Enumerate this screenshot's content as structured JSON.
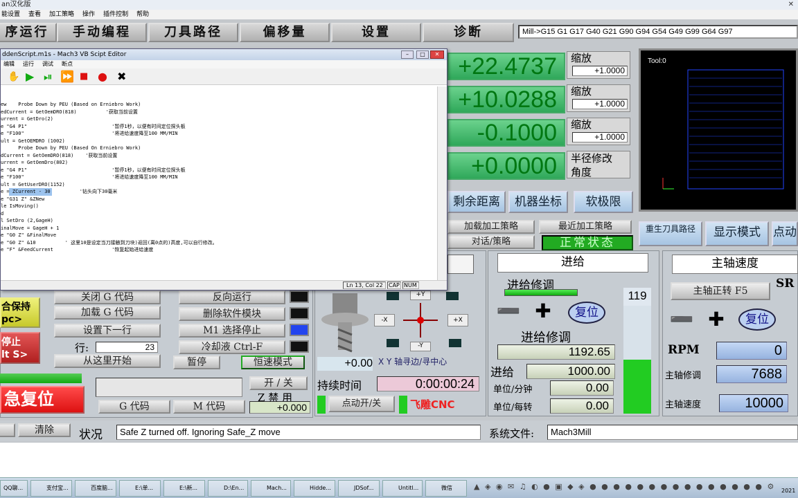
{
  "window": {
    "title": "an汉化版"
  },
  "menubar": [
    "能设置",
    "查看",
    "加工策略",
    "操作",
    "插件控制",
    "帮助"
  ],
  "tabs": [
    "序运行",
    "手动编程",
    "刀具路径",
    "偏移量",
    "设置",
    "诊断"
  ],
  "mdi": "Mill->G15  G1 G17 G40 G21 G90 G94 G54 G49 G99 G64 G97",
  "dros": [
    {
      "value": "+22.4737",
      "scale_label": "缩放",
      "scale": "+1.0000"
    },
    {
      "value": "+10.0288",
      "scale_label": "缩放",
      "scale": "+1.0000"
    },
    {
      "value": "-0.1000",
      "scale_label": "缩放",
      "scale": "+1.0000"
    },
    {
      "value": "+0.0000",
      "scale_label": "半径修改\n角度"
    }
  ],
  "tool_label": "Tool:0",
  "coord_buttons": [
    "剩余距离",
    "机器坐标",
    "软极限"
  ],
  "strategy": {
    "load": "加载加工策略",
    "recent": "最近加工策略",
    "dialog": "对话/策略",
    "status": "正常状态"
  },
  "right_buttons": [
    "重生刀具路径",
    "显示模式",
    "点动"
  ],
  "editor": {
    "title": "ddenScript.m1s - Mach3 VB Scipt Editor",
    "menu": [
      "编辑",
      "运行",
      "调试",
      "断点"
    ],
    "status": {
      "pos": "Ln 13, Col 22",
      "cap": "CAP",
      "num": "NUM"
    },
    "code": [
      "ew    Probe Down by PEU (Based on Erniebro Work)",
      "edCurrent = GetOemDRO(818)          '获取当前设置",
      "urrent = GetDro(2)",
      "e \"G4 P1\"                             '暂停1秒，以便有时间定位探头板",
      "e \"F100\"                              '将进给速度降至100 MM/MIN",
      "ult = GetOEMDRO (1002)",
      "      Probe Down by PEU (Based On Erniebro Work)",
      "dCurrent = GetOemDRO(818)    '获取当前设置",
      "urrent = GetOemDro(802)",
      "e \"G4 P1\"                             '暂停1秒，以便有时间定位探头板",
      "e \"F100\"                              '将进给速度降至100 MM/MIN",
      "ult = GetUserDRO(1152)",
      "e = ZCurrent - 30          '钻头向下30毫米",
      "e \"G31 Z\" &ZNew",
      "le IsMoving()",
      "d",
      "l SetDro (2,GageH)",
      "inalMove = GageH + 1",
      "e \"G0 Z\" &FinalMove",
      "e \"G0 Z\" &10          ' 这里10是设定当刀接触到刀块)返回(离0点的)高度,可以自行修改。",
      "e \"F\" &FeedCurrent                    '恢复起始进给速度"
    ]
  },
  "left_buttons": {
    "close": "关闭 G 代码",
    "load": "加载 G 代码",
    "set_next": "设置下一行",
    "line_label": "行:",
    "line_value": "23",
    "run_from": "从这里开始",
    "hold": "合保持\npc>",
    "stop": "停止\nlt S>",
    "reverse": "反向运行",
    "del_module": "删除软件模块",
    "m1": "M1 选择停止",
    "coolant": "冷却液 Ctrl-F",
    "pause": "暂停",
    "cv": "恒速模式"
  },
  "jog": {
    "y_plus": "+Y",
    "y_minus": "-Y",
    "x_minus": "-X",
    "x_plus": "+X",
    "center_label": "X Y 轴寻边/寻中心",
    "value": "+0.00"
  },
  "duration": {
    "label": "持续时间",
    "value": "0:00:00:24",
    "jog_toggle": "点动开/关",
    "brand": "飞雕CNC"
  },
  "estop": {
    "label": "急复位",
    "gcode": "G 代码",
    "mcode": "M 代码",
    "onoff": "开 / 关",
    "z_disable": "Z 禁 用",
    "z_value": "+0.000"
  },
  "feed": {
    "header": "进给",
    "override_label": "进给修调",
    "reset": "复位",
    "percent": "119",
    "override_value_label": "进给修调",
    "override_value": "1192.65",
    "feed_label": "进给",
    "feed_value": "1000.00",
    "per_min_label": "单位/分钟",
    "per_min": "0.00",
    "per_rev_label": "单位/每转",
    "per_rev": "0.00"
  },
  "spindle": {
    "header": "主轴速度",
    "cw": "主轴正转 F5",
    "sr": "SR",
    "reset": "复位",
    "rpm_label": "RPM",
    "rpm": "0",
    "override_label": "主轴修调",
    "override": "7688",
    "speed_label": "主轴速度",
    "speed": "10000"
  },
  "statusbar": {
    "clear": "清除",
    "label": "状况",
    "message": "Safe Z turned off. Ignoring Safe_Z move",
    "file_label": "系统文件:",
    "file": "Mach3Mill"
  },
  "taskbar": [
    "QQ聊...",
    "支付宝...",
    "百度脑...",
    "E:\\单...",
    "E:\\新...",
    "D:\\En...",
    "Mach...",
    "Hidde...",
    "JDSof...",
    "Untitl...",
    "微信"
  ],
  "clock": "2021"
}
